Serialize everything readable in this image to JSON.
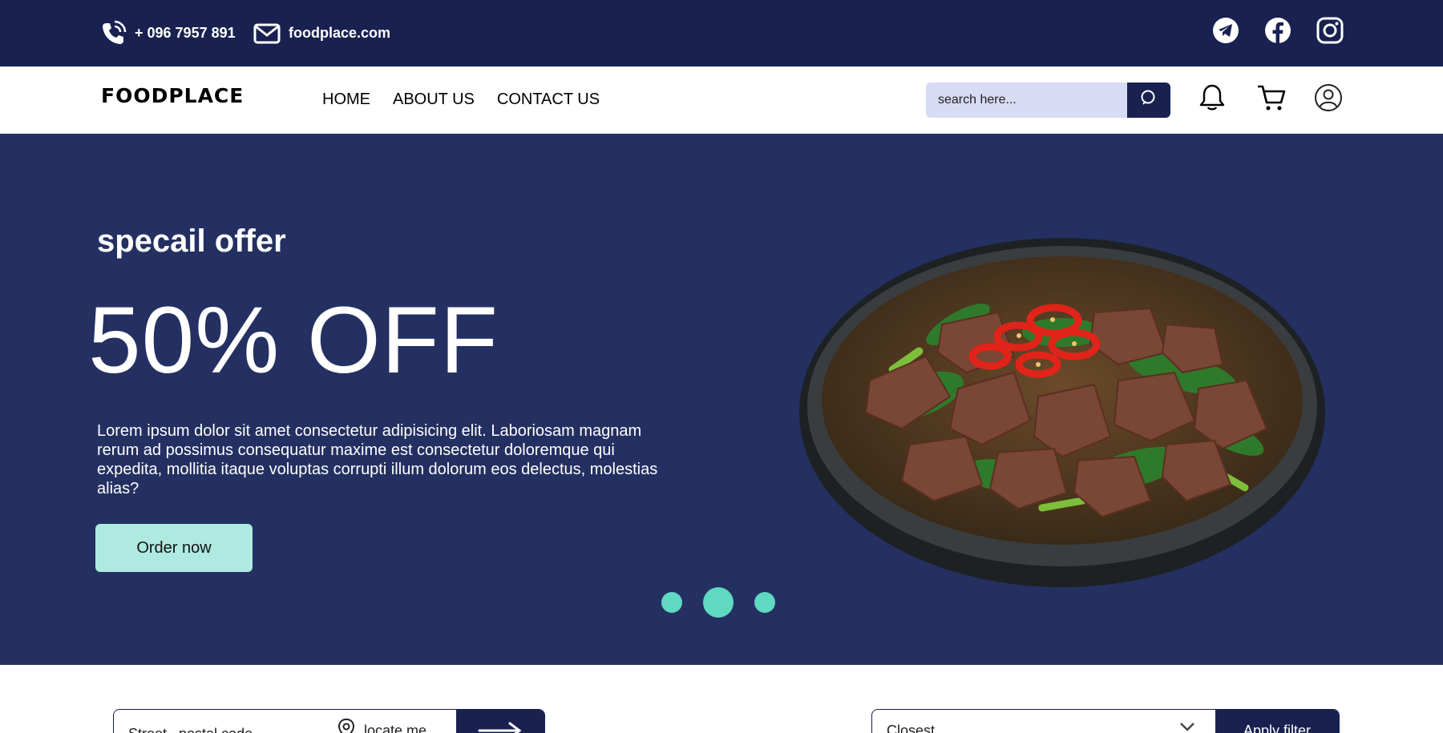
{
  "topbar": {
    "phone": "+ 096 7957 891",
    "website": "foodplace.com",
    "social_icons": [
      "telegram-icon",
      "facebook-icon",
      "instagram-icon"
    ]
  },
  "nav": {
    "logo": "FOODPLACE",
    "menu": [
      "HOME",
      "ABOUT US",
      "CONTACT US"
    ],
    "search_placeholder": "search here...",
    "icons": [
      "search-icon",
      "bell-icon",
      "cart-icon",
      "user-icon"
    ]
  },
  "hero": {
    "subtitle": "specail offer",
    "title": "50% OFF",
    "description": "Lorem ipsum dolor sit amet consectetur adipisicing elit. Laboriosam magnam rerum ad possimus consequatur maxime est consectetur doloremque qui expedita, mollitia itaque voluptas corrupti illum dolorum eos delectus, molestias alias?",
    "button": "Order now",
    "slides_count": 3,
    "active_slide": 2
  },
  "filters": {
    "location_placeholder": "Street , postal code",
    "locate_label": "locate me",
    "sort_value": "Closest",
    "apply_label": "Apply filter"
  },
  "colors": {
    "topbar": "#182150",
    "hero": "#243061",
    "accent": "#5fd9c2",
    "button": "#aeeae0",
    "search_bg": "#d7dbf3"
  }
}
